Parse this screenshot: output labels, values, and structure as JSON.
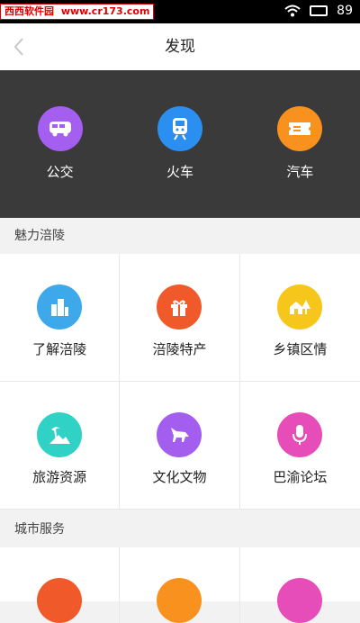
{
  "status_bar": {
    "watermark_name": "西西软件园",
    "watermark_url": "www.cr173.com",
    "battery": "89"
  },
  "navbar": {
    "title": "发现"
  },
  "transport": [
    {
      "label": "公交",
      "icon": "bus-icon",
      "color": "#a45ef0"
    },
    {
      "label": "火车",
      "icon": "train-icon",
      "color": "#2a8ff0"
    },
    {
      "label": "汽车",
      "icon": "ticket-icon",
      "color": "#f8911e"
    }
  ],
  "sections": [
    {
      "title": "魅力涪陵",
      "items": [
        {
          "label": "了解涪陵",
          "icon": "building-icon",
          "color": "#3da8ea"
        },
        {
          "label": "涪陵特产",
          "icon": "gift-icon",
          "color": "#f05a2a"
        },
        {
          "label": "乡镇区情",
          "icon": "village-icon",
          "color": "#f6c61b"
        },
        {
          "label": "旅游资源",
          "icon": "palm-icon",
          "color": "#2fd2c4"
        },
        {
          "label": "文化文物",
          "icon": "horse-icon",
          "color": "#a35ef0"
        },
        {
          "label": "巴渝论坛",
          "icon": "microphone-icon",
          "color": "#e64db8"
        }
      ]
    },
    {
      "title": "城市服务",
      "items": [
        {
          "icon": "service-icon-1",
          "color": "#f05a2a"
        },
        {
          "icon": "service-icon-2",
          "color": "#f8911e"
        },
        {
          "icon": "service-icon-3",
          "color": "#e64db8"
        }
      ]
    }
  ]
}
